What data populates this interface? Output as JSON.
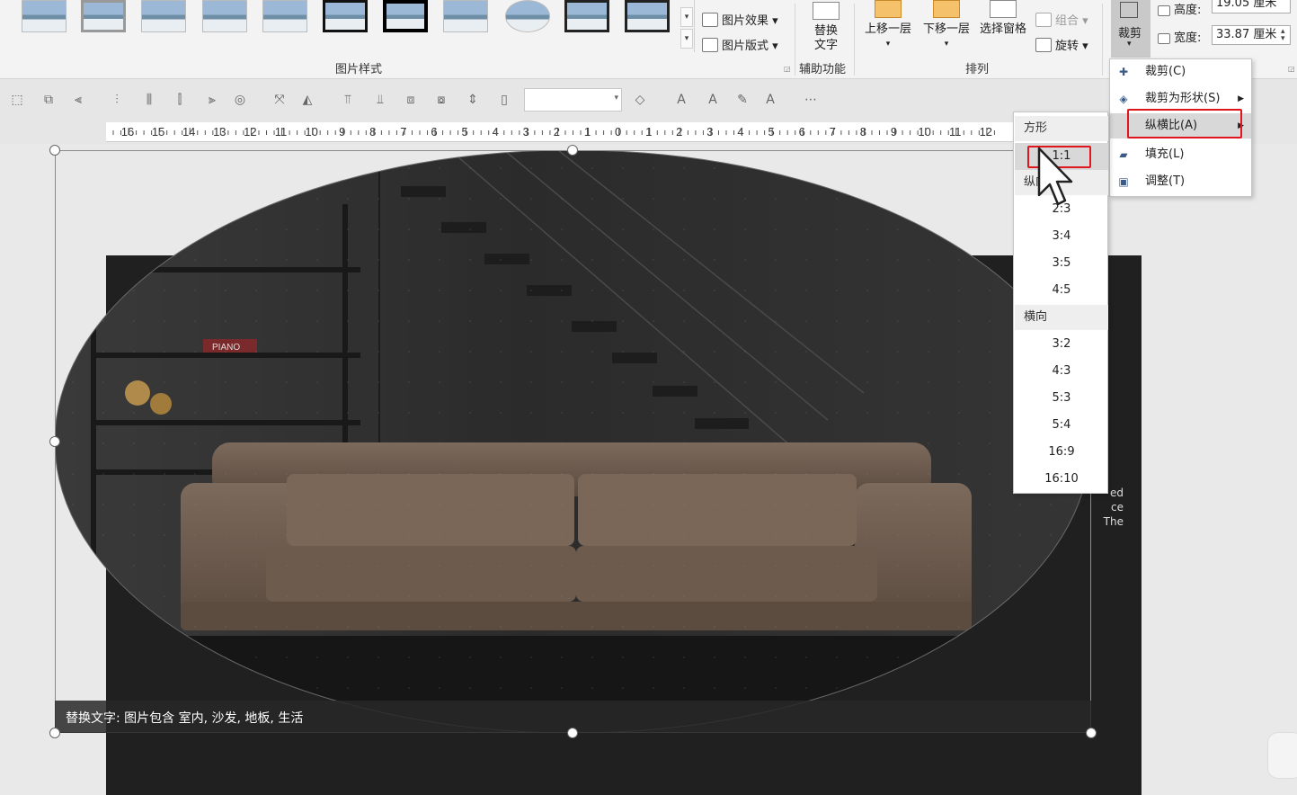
{
  "ribbon": {
    "picture_styles_label": "图片样式",
    "picture_effects": "图片效果",
    "picture_layout": "图片版式",
    "alt_text_line1": "替换",
    "alt_text_line2": "文字",
    "accessibility_label": "辅助功能",
    "bring_forward": "上移一层",
    "send_backward": "下移一层",
    "selection_pane": "选择窗格",
    "group": "组合",
    "rotate": "旋转",
    "arrange_label": "排列",
    "crop": "裁剪",
    "height_label": "高度:",
    "height_value": "19.05 厘米",
    "width_label": "宽度:",
    "width_value": "33.87 厘米"
  },
  "crop_menu": {
    "items": [
      {
        "label": "裁剪(C)",
        "icon": "crop-icon"
      },
      {
        "label": "裁剪为形状(S)",
        "icon": "shape-icon",
        "has_submenu": true
      },
      {
        "label": "纵横比(A)",
        "icon": "",
        "has_submenu": true,
        "highlighted": true
      },
      {
        "label": "填充(L)",
        "icon": "fill-icon"
      },
      {
        "label": "调整(T)",
        "icon": "fit-icon"
      }
    ]
  },
  "aspect_menu": {
    "square_header": "方形",
    "square_items": [
      "1:1"
    ],
    "portrait_header": "纵向",
    "portrait_items": [
      "2:3",
      "3:4",
      "3:5",
      "4:5"
    ],
    "landscape_header": "横向",
    "landscape_items": [
      "3:2",
      "4:3",
      "5:3",
      "5:4",
      "16:9",
      "16:10"
    ],
    "highlighted": "1:1"
  },
  "ruler": {
    "labels": [
      "16",
      "15",
      "14",
      "13",
      "12",
      "11",
      "10",
      "9",
      "8",
      "7",
      "6",
      "5",
      "4",
      "3",
      "2",
      "1",
      "0",
      "1",
      "2",
      "3",
      "4",
      "5",
      "6",
      "7",
      "8",
      "9",
      "10",
      "11",
      "12"
    ]
  },
  "picture": {
    "alt_text": "替换文字: 图片包含 室内, 沙发, 地板, 生活",
    "book_label": "PIANO",
    "bg_text": [
      "ed",
      "ce",
      "The"
    ]
  },
  "colors": {
    "highlight_box": "#e0161e",
    "menu_highlight": "#d8d8d8",
    "sofa": "#6f5d4f"
  }
}
